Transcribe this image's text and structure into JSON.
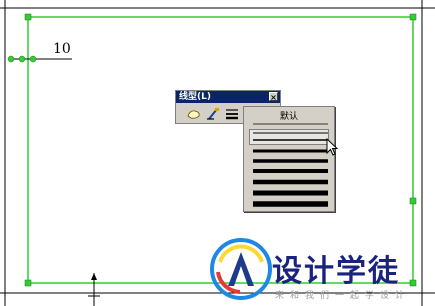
{
  "drawing": {
    "dimension_value": "10"
  },
  "toolbar": {
    "title": "线型(L)",
    "close_symbol": "×"
  },
  "linetype_dropdown": {
    "header": "默认",
    "items": [
      {
        "name": "thin-1"
      },
      {
        "name": "thin-2"
      },
      {
        "name": "medium-1"
      },
      {
        "name": "medium-2"
      },
      {
        "name": "medium-3"
      },
      {
        "name": "thick-1"
      },
      {
        "name": "thick-2"
      },
      {
        "name": "thick-3"
      },
      {
        "name": "thick-4"
      }
    ]
  },
  "watermark": {
    "brand": "设计学徒",
    "slogan": "来和我们一起学设计",
    "brand_colors": [
      "#e53935",
      "#fdd835",
      "#1e88e5"
    ]
  }
}
